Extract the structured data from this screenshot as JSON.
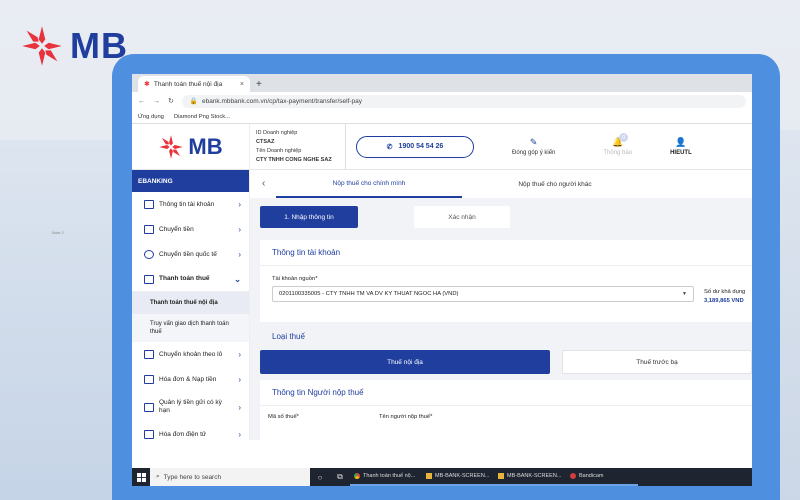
{
  "brand": {
    "name": "MB"
  },
  "browser": {
    "tab_title": "Thanh toán thuế nội địa",
    "new_tab": "+",
    "url": "ebank.mbbank.com.vn/cp/tax-payment/transfer/self-pay",
    "bookmarks": [
      "Ứng dụng",
      "Diamond Png Stock..."
    ]
  },
  "header": {
    "logo": "MB",
    "company_id_label": "ID Doanh nghiệp",
    "company_id": "CTSAZ",
    "company_name_label": "Tên Doanh nghiệp",
    "company_name": "CTY TNHH CONG NGHE SAZ",
    "hotline": "1900 54 54 26",
    "feedback": "Đóng góp ý kiến",
    "notification_count": "0",
    "notification_label": "Thông báo",
    "user": "HIEUTL"
  },
  "sidebar": {
    "title": "EBANKING",
    "items": [
      {
        "label": "Thông tin tài khoản"
      },
      {
        "label": "Chuyển tiền"
      },
      {
        "label": "Chuyển tiền quốc tế"
      },
      {
        "label": "Thanh toán thuế"
      }
    ],
    "sub_items": [
      {
        "label": "Thanh toán thuế nội địa"
      },
      {
        "label": "Truy vấn giao dịch thanh toán thuế"
      }
    ],
    "items_after": [
      {
        "label": "Chuyển khoản theo lô"
      },
      {
        "label": "Hóa đơn & Nạp tiền"
      },
      {
        "label": "Quản lý tiền gửi có kỳ hạn"
      },
      {
        "label": "Hóa đơn điện tử"
      }
    ]
  },
  "main": {
    "tabs": [
      "Nộp thuế cho chính mình",
      "Nộp thuế cho người khác"
    ],
    "steps": [
      "1.  Nhập thông tin",
      "Xác nhận"
    ],
    "account_section": "Thông tin tài khoản",
    "source_account_label": "Tài khoản nguồn*",
    "source_account_value": "0201100335005 - CTY TNHH TM VA DV KY THUAT NGOC HA (VND)",
    "balance_label": "Số dư khả dụng",
    "balance_value": "3,189,865 VND",
    "tax_type_section": "Loại thuế",
    "tax_types": [
      "Thuế nội địa",
      "Thuế trước bạ"
    ],
    "payer_section": "Thông tin Người nộp thuế",
    "tax_code_label": "Mã số thuế*",
    "payer_name_label": "Tên người nộp thuế*"
  },
  "taskbar": {
    "search": "Type here to search",
    "apps": [
      "Thanh toán thuế nộ...",
      "MB-BANK-SCREEN...",
      "MB-BANK-SCREEN...",
      "Bandicam"
    ]
  },
  "colors": {
    "brand_blue": "#1f3e9e",
    "brand_red": "#e8323c",
    "laptop_blue": "#4f8fe0"
  }
}
